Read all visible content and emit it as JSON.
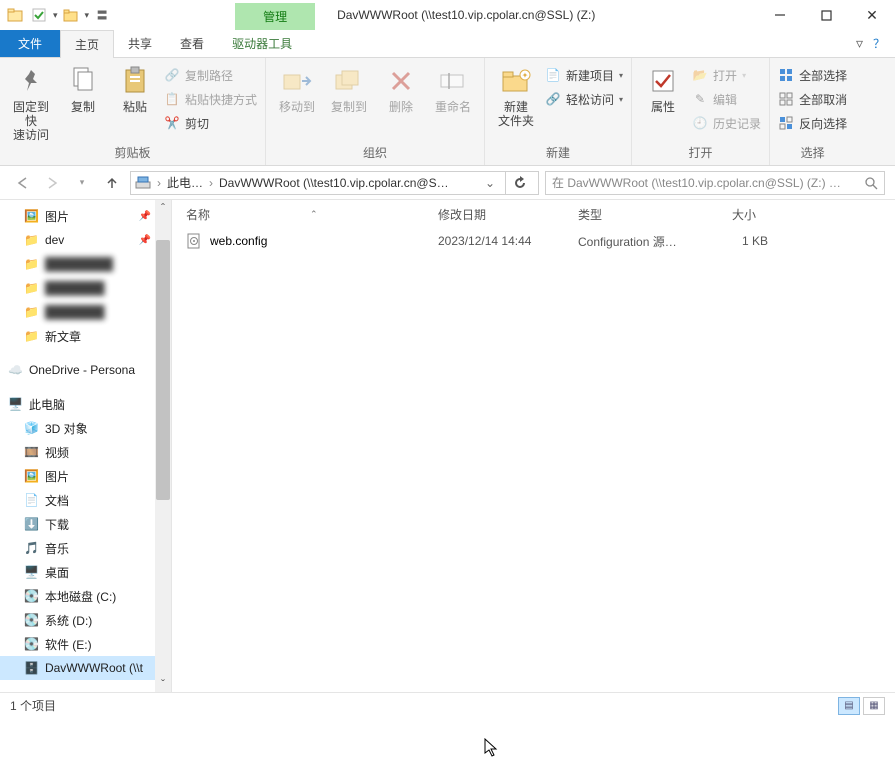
{
  "window": {
    "context_tab": "管理",
    "title": "DavWWWRoot (\\\\test10.vip.cpolar.cn@SSL) (Z:)"
  },
  "tabs": {
    "file": "文件",
    "home": "主页",
    "share": "共享",
    "view": "查看",
    "drivetools": "驱动器工具"
  },
  "ribbon": {
    "pin": "固定到快\n速访问",
    "copy": "复制",
    "paste": "粘贴",
    "copypath": "复制路径",
    "pasteshortcut": "粘贴快捷方式",
    "cut": "剪切",
    "group_clipboard": "剪贴板",
    "moveto": "移动到",
    "copyto": "复制到",
    "delete": "删除",
    "rename": "重命名",
    "group_organize": "组织",
    "newfolder": "新建\n文件夹",
    "newitem": "新建项目",
    "easyaccess": "轻松访问",
    "group_new": "新建",
    "properties": "属性",
    "open": "打开",
    "edit": "编辑",
    "history": "历史记录",
    "group_open": "打开",
    "selectall": "全部选择",
    "selectnone": "全部取消",
    "invert": "反向选择",
    "group_select": "选择"
  },
  "breadcrumb": {
    "root": "此电…",
    "current": "DavWWWRoot (\\\\test10.vip.cpolar.cn@S…"
  },
  "search": {
    "placeholder": "在 DavWWWRoot (\\\\test10.vip.cpolar.cn@SSL) (Z:) …"
  },
  "tree": {
    "pictures": "图片",
    "dev": "dev",
    "blur1": "—",
    "blur2": "—",
    "blur3": "—",
    "newarticle": "新文章",
    "onedrive": "OneDrive - Persona",
    "thispc": "此电脑",
    "obj3d": "3D 对象",
    "videos": "视频",
    "pics": "图片",
    "docs": "文档",
    "downloads": "下载",
    "music": "音乐",
    "desktop": "桌面",
    "driveC": "本地磁盘 (C:)",
    "driveD": "系统 (D:)",
    "driveE": "软件 (E:)",
    "netdrive": "DavWWWRoot (\\\\t"
  },
  "columns": {
    "name": "名称",
    "date": "修改日期",
    "type": "类型",
    "size": "大小"
  },
  "files": [
    {
      "name": "web.config",
      "date": "2023/12/14 14:44",
      "type": "Configuration 源…",
      "size": "1 KB"
    }
  ],
  "status": {
    "items": "1 个项目"
  }
}
